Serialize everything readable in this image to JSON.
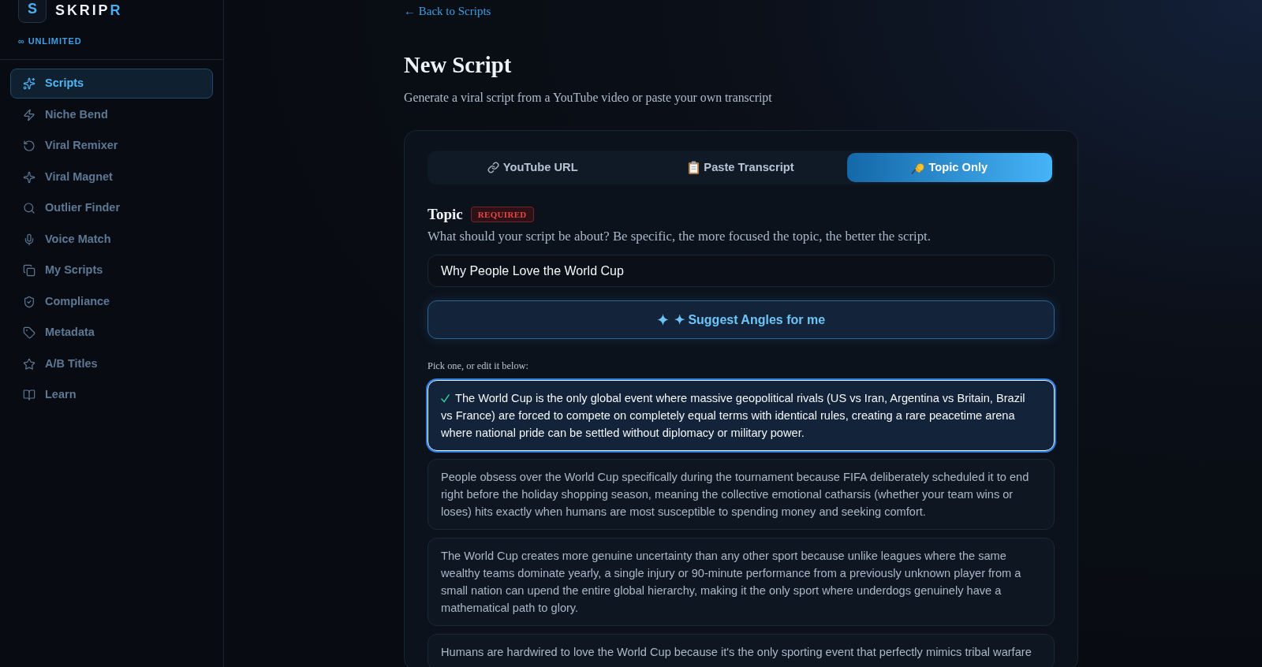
{
  "sidebar": {
    "logo_letter": "S",
    "wordmark": "SKRIPR",
    "plan": "∞ UNLIMITED",
    "items": [
      {
        "label": "Scripts",
        "selected": true
      },
      {
        "label": "Niche Bend",
        "selected": false
      },
      {
        "label": "Viral Remixer",
        "selected": false
      },
      {
        "label": "Viral Magnet",
        "selected": false
      },
      {
        "label": "Outlier Finder",
        "selected": false
      },
      {
        "label": "Voice Match",
        "selected": false
      },
      {
        "label": "My Scripts",
        "selected": false
      },
      {
        "label": "Compliance",
        "selected": false
      },
      {
        "label": "Metadata",
        "selected": false
      },
      {
        "label": "A/B Titles",
        "selected": false
      },
      {
        "label": "Learn",
        "selected": false
      }
    ]
  },
  "back_link": "← Back to Scripts",
  "header": {
    "title": "New Script",
    "subtitle": "Generate a viral script from a YouTube video or paste your own transcript"
  },
  "form": {
    "tabs": [
      {
        "label": "YouTube URL",
        "selected": false
      },
      {
        "label": "Paste Transcript",
        "selected": false
      },
      {
        "label": "Topic Only",
        "selected": true
      }
    ],
    "topic": {
      "label": "Topic",
      "badge": "REQUIRED",
      "help": "What should your script be about? Be specific, the more focused the topic, the better the script.",
      "value": "Why People Love the World Cup"
    },
    "suggest_button": "✦ Suggest Angles for me",
    "angles_hint": "Pick one, or edit it below:",
    "angles": [
      {
        "text": "The World Cup is the only global event where massive geopolitical rivals (US vs Iran, Argentina vs Britain, Brazil vs France) are forced to compete on completely equal terms with identical rules, creating a rare peacetime arena where national pride can be settled without diplomacy or military power.",
        "selected": true
      },
      {
        "text": "People obsess over the World Cup specifically during the tournament because FIFA deliberately scheduled it to end right before the holiday shopping season, meaning the collective emotional catharsis (whether your team wins or loses) hits exactly when humans are most susceptible to spending money and seeking comfort.",
        "selected": false
      },
      {
        "text": "The World Cup creates more genuine uncertainty than any other sport because unlike leagues where the same wealthy teams dominate yearly, a single injury or 90-minute performance from a previously unknown player from a small nation can upend the entire global hierarchy, making it the only sport where underdogs genuinely have a mathematical path to glory.",
        "selected": false
      },
      {
        "text": "Humans are hardwired to love the World Cup because it's the only sporting event that perfectly mimics tribal warfare",
        "selected": false
      }
    ]
  }
}
